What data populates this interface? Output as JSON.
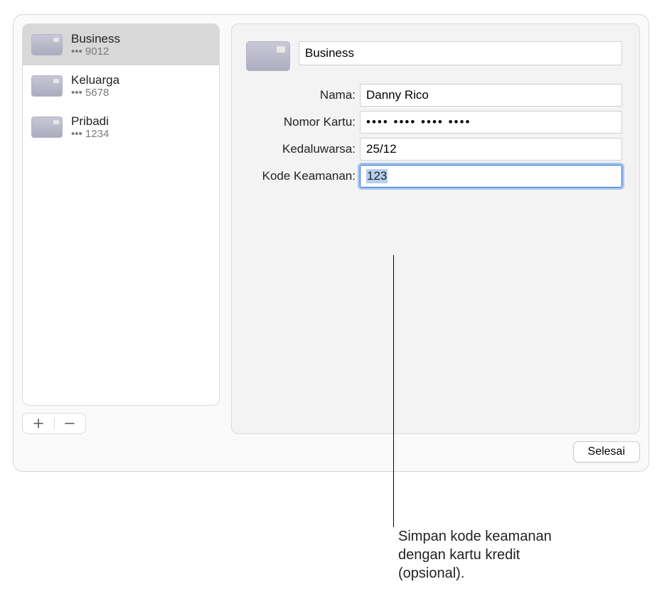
{
  "sidebar": {
    "items": [
      {
        "title": "Business",
        "sub": "••• 9012",
        "selected": true
      },
      {
        "title": "Keluarga",
        "sub": "••• 5678",
        "selected": false
      },
      {
        "title": "Pribadi",
        "sub": "••• 1234",
        "selected": false
      }
    ]
  },
  "detail": {
    "title_value": "Business",
    "fields": {
      "name": {
        "label": "Nama:",
        "value": "Danny Rico"
      },
      "number": {
        "label": "Nomor Kartu:",
        "value": "•••• •••• •••• ••••"
      },
      "expiry": {
        "label": "Kedaluwarsa:",
        "value": "25/12"
      },
      "code": {
        "label": "Kode Keamanan:",
        "value": "123"
      }
    }
  },
  "buttons": {
    "done": "Selesai"
  },
  "callout": "Simpan kode keamanan dengan kartu kredit (opsional)."
}
